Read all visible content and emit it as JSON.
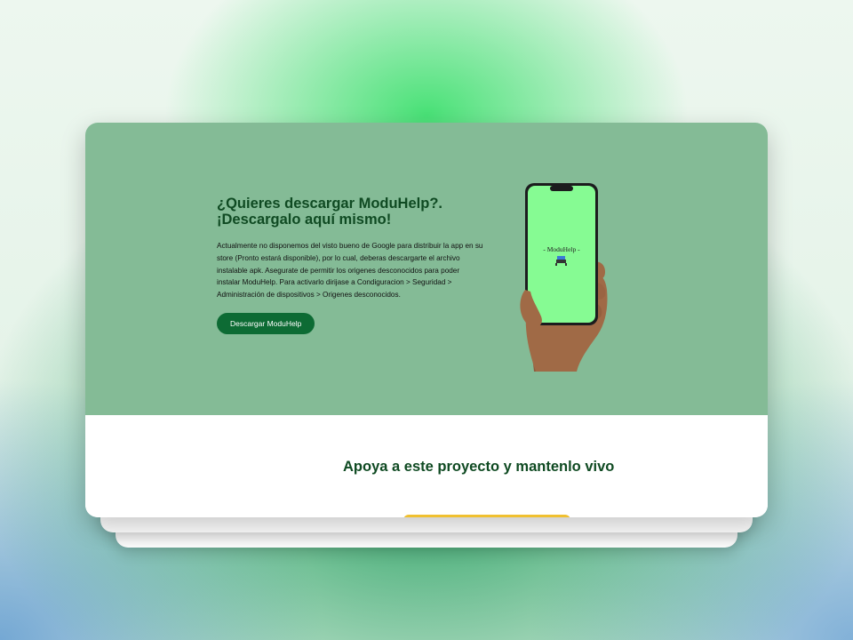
{
  "hero": {
    "title_line1": "¿Quieres descargar ModuHelp?.",
    "title_line2": "¡Descargalo aquí mismo!",
    "description": "Actualmente no disponemos del visto bueno de Google para distribuir la app en su store (Pronto estará disponible), por lo cual, deberas descargarte el archivo instalable apk. Asegurate de permitir los origenes desconocidos para poder instalar ModuHelp. Para activarlo dirijase a Condiguracion > Seguridad > Administración de dispositivos > Origenes desconocidos.",
    "download_button": "Descargar ModuHelp",
    "phone_screen_label": "- ModuHelp -"
  },
  "support": {
    "title": "Apoya a este proyecto y mantenlo vivo"
  },
  "colors": {
    "hero_bg": "#84bb96",
    "primary_green": "#0d6b34",
    "title_green": "#0f4a22",
    "phone_screen": "#86fb93",
    "accent_yellow": "#f0c030"
  }
}
